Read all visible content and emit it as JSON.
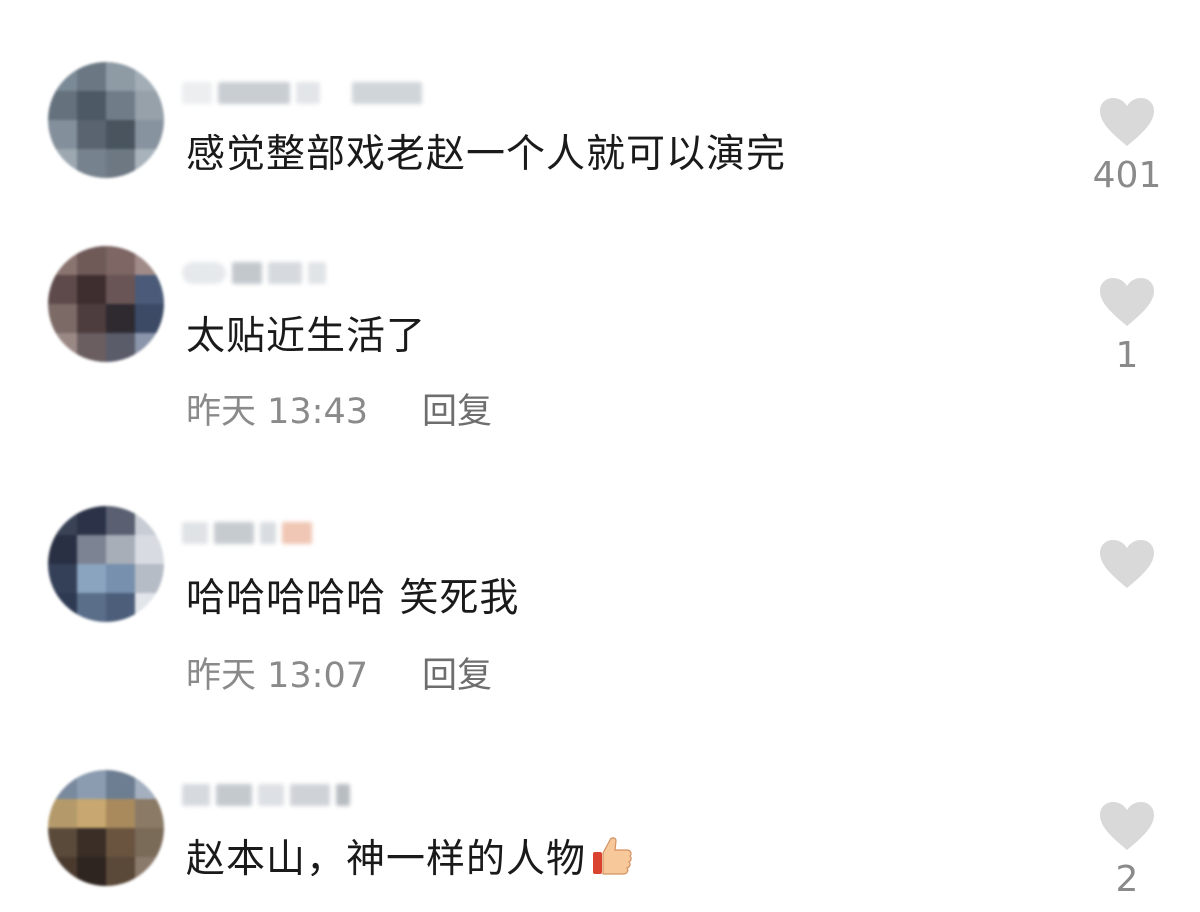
{
  "comments": [
    {
      "text": "感觉整部戏老赵一个人就可以演完",
      "likes": "401",
      "time": "",
      "reply": ""
    },
    {
      "text": "太贴近生活了",
      "likes": "1",
      "time": "昨天 13:43",
      "reply": "回复"
    },
    {
      "text": "哈哈哈哈哈 笑死我",
      "likes": "",
      "time": "昨天 13:07",
      "reply": "回复"
    },
    {
      "text": "赵本山，神一样的人物",
      "likes": "2",
      "time": "",
      "reply": ""
    }
  ],
  "icons": {
    "like": "heart-icon",
    "emoji": "thumbs-up-icon"
  },
  "colors": {
    "heart": "#d9d9d9",
    "text": "#1a1a1a",
    "meta": "#8a8a8a"
  }
}
